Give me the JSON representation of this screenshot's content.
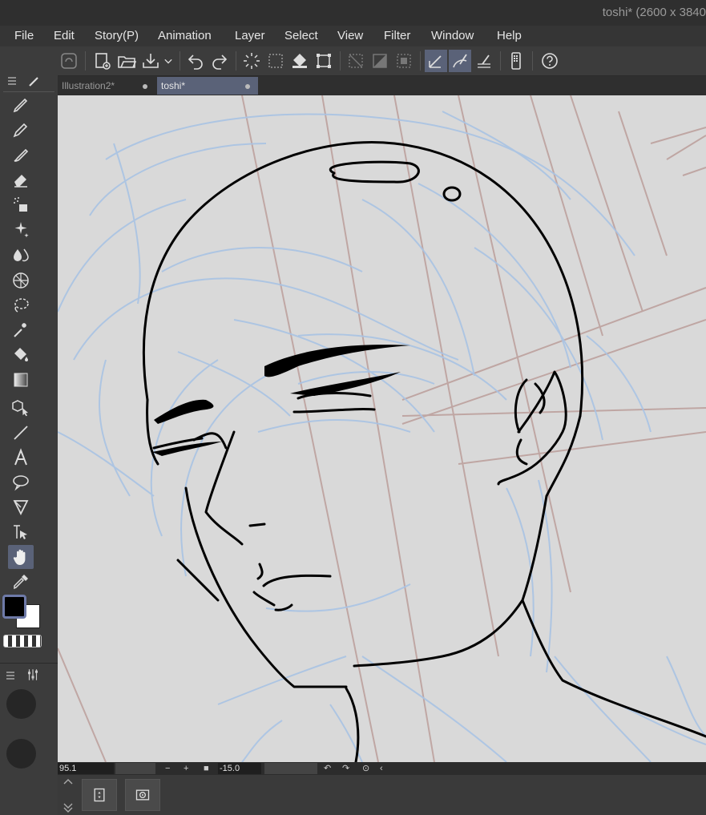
{
  "window": {
    "title": "toshi* (2600 x 3840"
  },
  "menu": [
    "File",
    "Edit",
    "Story(P)",
    "Animation",
    "Layer",
    "Select",
    "View",
    "Filter",
    "Window",
    "Help"
  ],
  "tabs": [
    {
      "label": "Illustration2*",
      "active": false
    },
    {
      "label": "toshi*",
      "active": true
    }
  ],
  "status": {
    "zoom": "95.1",
    "angle": "-15.0"
  },
  "colors": {
    "main": "#000000",
    "sub": "#ffffff",
    "accent": "#5a6278"
  },
  "toolbar_icons": [
    "cloud-icon",
    "new-canvas-icon",
    "open-icon",
    "save-icon",
    "dropdown-icon",
    "undo-icon",
    "redo-icon",
    "deselect-icon",
    "select-all-icon",
    "fill-icon",
    "transform-icon",
    "hide-selection-icon",
    "invert-selection-icon",
    "border-icon",
    "snap-ruler-icon",
    "snap-special-ruler-icon",
    "snap-grid-icon",
    "smartphone-icon",
    "help-icon"
  ],
  "left_tools": [
    "pen-icon",
    "pencil-icon",
    "brush-icon",
    "eraser-icon",
    "airbrush-icon",
    "decoration-icon",
    "blend-icon",
    "operation-icon",
    "lasso-icon",
    "auto-select-icon",
    "fill-tool-icon",
    "gradient-icon",
    "move-layer-icon",
    "figure-icon",
    "text-icon",
    "balloon-icon",
    "frame-border-icon",
    "ruler-icon",
    "hand-icon",
    "eyedropper-icon"
  ]
}
